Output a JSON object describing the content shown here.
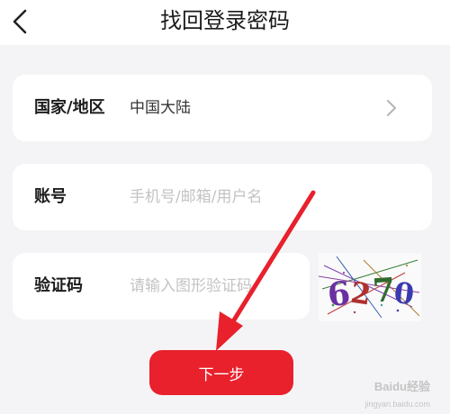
{
  "header": {
    "title": "找回登录密码",
    "back_icon": "chevron-left-icon"
  },
  "form": {
    "region": {
      "label": "国家/地区",
      "value": "中国大陆",
      "chevron_icon": "chevron-right-icon"
    },
    "account": {
      "label": "账号",
      "placeholder": "手机号/邮箱/用户名"
    },
    "captcha": {
      "label": "验证码",
      "placeholder": "请输入图形验证码",
      "image_text": "6270"
    }
  },
  "actions": {
    "next_label": "下一步"
  },
  "colors": {
    "accent": "#e8212d",
    "background": "#f4f4f6",
    "card": "#ffffff",
    "placeholder": "#c3c3c3"
  },
  "watermark": {
    "brand": "Baidu经验",
    "url": "jingyan.baidu.com"
  }
}
